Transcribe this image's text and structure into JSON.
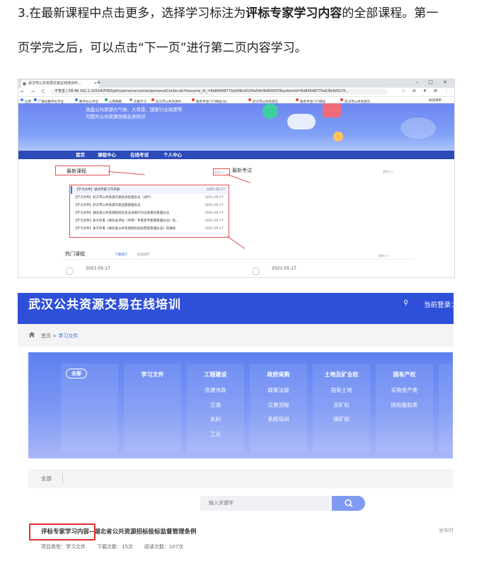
{
  "instructions": {
    "p1_prefix": "3.在最新课程中点击更多，选择学习标注为",
    "p1_bold": "评标专家学习内容",
    "p1_suffix": "的全部课程。第一",
    "p2": "页学完之后，可以点击“下一页”进行第二页内容学习。"
  },
  "browser": {
    "tab_title": "武汉市公共资源交易在线培训中...",
    "tab_close": "×",
    "new_tab": "+",
    "window_controls": "–  □  ×",
    "nav_buttons": "← → C ⌂",
    "security_label": "不安全",
    "url": "58.48.162.1:10104/PXKS/pfrs/personal-center/personalCenter.do?resource_id_=8a80648770a548cd01f0a54cf9d000078systemId=8a80648770a53b4d0170...",
    "toolbar_icons": "☆ ⊕ ★ ⊞ ⋮",
    "bookmarks": [
      "应用",
      "广联达数字化平台",
      "数字办公平台",
      "公用邮箱",
      "云服学习",
      "武汉市公共资源中...",
      "服务平台门户网站(光)",
      "武汉市公共资源交...",
      "服务平台门户网站",
      "武汉市公共资源交..."
    ],
    "bookmarks_extra": "阅读清单"
  },
  "site1": {
    "banner_line1": "涵盖公共资源大气候、大背景、国家行业政策等",
    "banner_line2": "可提升公共资源领域业务知识",
    "nav": [
      "首页",
      "课程中心",
      "在线考试",
      "个人中心"
    ],
    "latest_courses": "最新课程",
    "more": "更多>>",
    "latest_exams": "最新考试",
    "course_list": [
      {
        "title": "【学习文件】湖北专家工作手册",
        "date": "2021-05-17"
      },
      {
        "title": "【学习文件】武汉市公共资源交易投诉处理办法（试行）",
        "date": "2021-05-17"
      },
      {
        "title": "【学习文件】武汉市公共资源交易监督管理办法",
        "date": "2021-05-17"
      },
      {
        "title": "【学习文件】湖北省公共资源招投标违法违规行为记录量化管理办法",
        "date": "2021-05-17"
      },
      {
        "title": "【学习文件】关于印发《湖北省评标（评审）专家及专家库管理办法》的...",
        "date": "2021-05-17"
      },
      {
        "title": "【学习文件】关于印发《湖北省公共资源招标投标档案管理办法》的通知",
        "date": "2021-05-17"
      }
    ],
    "hot_courses": "热门课程",
    "hot_tabs": [
      "下载排行",
      "阅读排行"
    ],
    "hot_date1": "2021-05-17",
    "hot_date2": "2021-05-17"
  },
  "site2": {
    "title": "武汉公共资源交易在线培训",
    "key_icon": "⚲",
    "login": "当前登录：刘",
    "breadcrumb_home": "首页",
    "breadcrumb_sep": " > ",
    "breadcrumb_current": "学习文件",
    "all_button": "全部",
    "categories": [
      {
        "head": "学习文件",
        "items": []
      },
      {
        "head": "工程建设",
        "items": [
          "房建市政",
          "交通",
          "水利",
          "工业"
        ]
      },
      {
        "head": "政府采购",
        "items": [
          "政策法规",
          "交易流程",
          "系统培训"
        ]
      },
      {
        "head": "土地及矿业权",
        "items": [
          "国有土地",
          "采矿权",
          "探矿权"
        ]
      },
      {
        "head": "国有产权",
        "items": [
          "实物资产类",
          "国有股权类"
        ]
      }
    ],
    "filter_all": "全部",
    "search_placeholder": "输入关键字",
    "result": {
      "title": "评标专家学习内容--湖北省公共资源招标投标监督管理条例",
      "type": "项目类型：学习文件",
      "downloads": "下载次数：15次",
      "reads": "阅读次数：107次",
      "publish": "发布时间"
    }
  }
}
